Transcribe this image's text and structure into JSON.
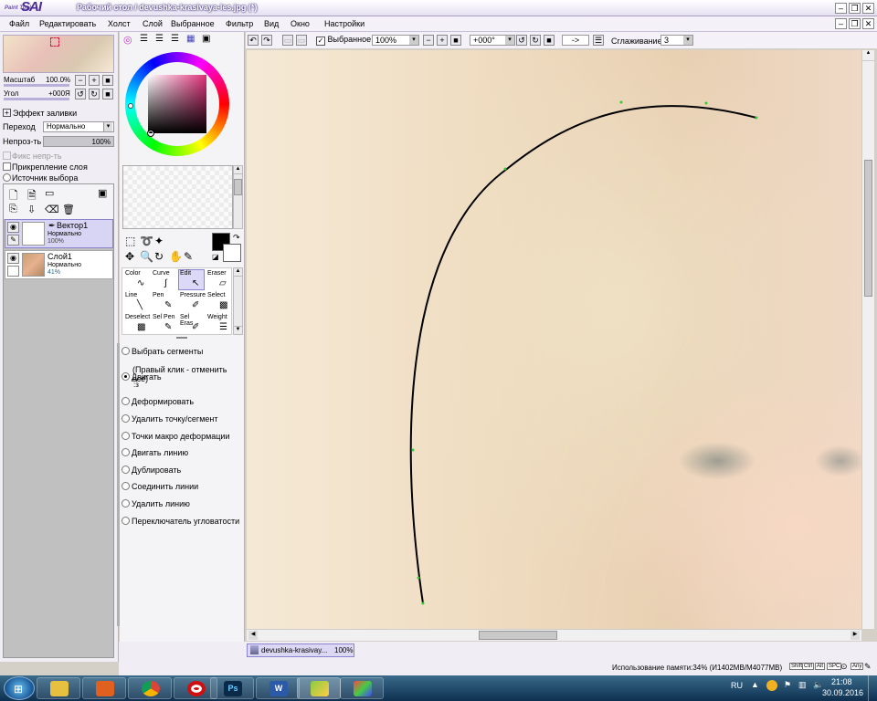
{
  "window": {
    "app_name": "SAI",
    "app_tag": "Paint Tool",
    "title": "Рабочий стол / devushka-krasivaya-les.jpg (*)",
    "min_icon": "minimize-icon",
    "restore_icon": "restore-icon",
    "close_icon": "close-icon"
  },
  "menu": [
    "Файл",
    "Редактировать",
    "Холст",
    "Слой",
    "Выбранное",
    "Фильтр",
    "Вид",
    "Окно",
    "Настройки"
  ],
  "navigator": {
    "zoom_label": "Масштаб",
    "zoom_value": "100.0%",
    "angle_label": "Угол",
    "angle_value": "+000Я"
  },
  "layer_props": {
    "fill_effect": "Эффект заливки",
    "blend_label": "Переход",
    "blend_value": "Нормально",
    "opacity_label": "Непроз-ть",
    "opacity_value": "100%",
    "opacity_fraction": 1.0,
    "fix_opacity": "Фикс непр-ть",
    "clip_layer": "Прикрепление слоя",
    "selection_source": "Источник выбора"
  },
  "layers": [
    {
      "name": "Вектор1",
      "mode": "Нормально",
      "opacity": "100%",
      "selected": true
    },
    {
      "name": "Слой1",
      "mode": "Нормально",
      "opacity": "41%",
      "selected": false
    }
  ],
  "tools": [
    {
      "label": "Color"
    },
    {
      "label": "Curve"
    },
    {
      "label": "Edit",
      "selected": true
    },
    {
      "label": "Eraser"
    },
    {
      "label": "Line"
    },
    {
      "label": "Pen"
    },
    {
      "label": "Pressure"
    },
    {
      "label": "Select"
    },
    {
      "label": "Deselect"
    },
    {
      "label": "Sel Pen"
    },
    {
      "label": "Sel Eras"
    },
    {
      "label": "Weight"
    }
  ],
  "edit_options": [
    {
      "label": "Выбрать сегменты",
      "checked": false
    },
    {
      "label": "(Правый клик - отменить всё)",
      "note": true
    },
    {
      "label": "Двигать",
      "sub": ":з",
      "checked": true
    },
    {
      "label": "Деформировать",
      "checked": false
    },
    {
      "label": "Удалить точку/сегмент",
      "checked": false
    },
    {
      "label": "Точки макро деформации",
      "checked": false
    },
    {
      "label": "Двигать линию",
      "checked": false
    },
    {
      "label": "Дублировать",
      "checked": false
    },
    {
      "label": "Соединить линии",
      "checked": false
    },
    {
      "label": "Удалить линию",
      "checked": false
    },
    {
      "label": "Переключатель угловатости",
      "checked": false
    }
  ],
  "toolbar": {
    "selection_label": "Выбранное",
    "zoom_value": "100%",
    "angle_value": "+000°",
    "arrow_label": "->",
    "smoothing_label": "Сглаживание",
    "smoothing_value": "3"
  },
  "doc_tab": {
    "name": "devushka-krasivay...",
    "zoom": "100%"
  },
  "status": {
    "memory": "Использование памяти:34% (И1402MB/M4077MB)",
    "keys": [
      "Shift",
      "Ctrl",
      "Alt",
      "SPC",
      "Any"
    ]
  },
  "taskbar": {
    "lang": "RU",
    "time": "21:08",
    "date": "30.09.2016"
  },
  "colors": {
    "accent": "#8a84d0",
    "title_text": "#ffffff",
    "primary_color": "#000000"
  }
}
